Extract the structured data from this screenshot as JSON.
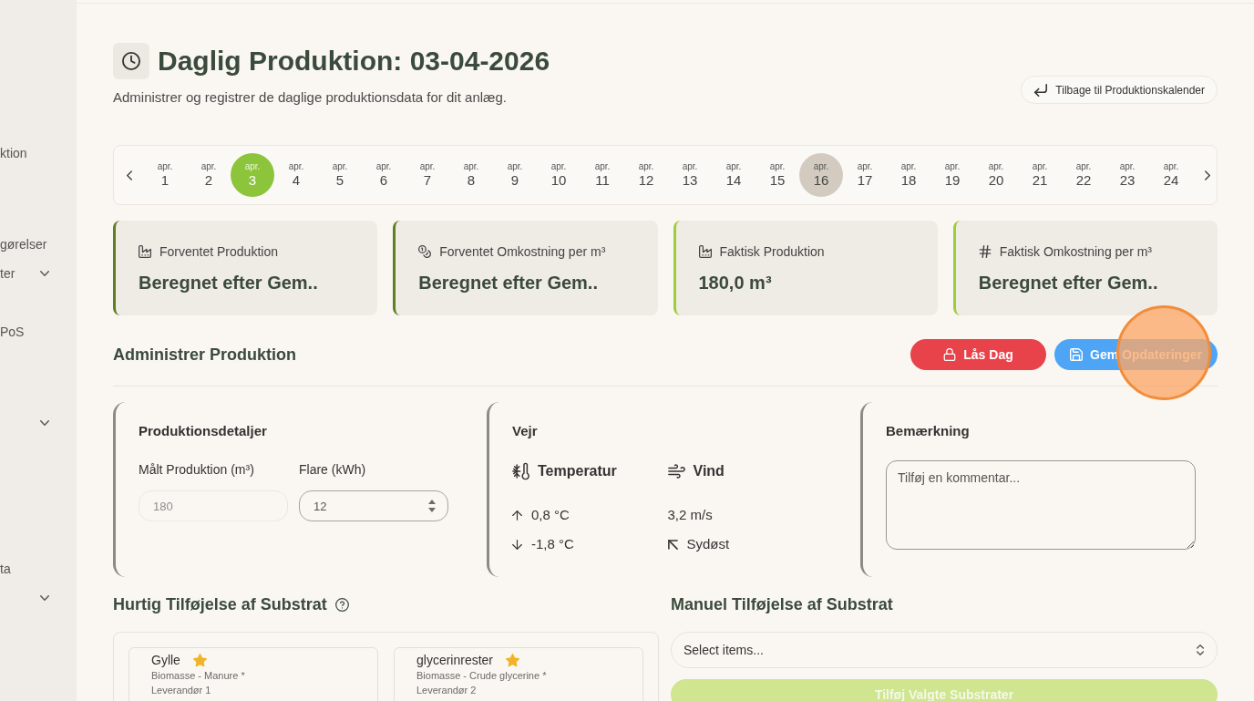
{
  "sidebar": {
    "items": [
      {
        "label": "ktion",
        "expandable": false
      },
      {
        "label": "gørelser",
        "expandable": false
      },
      {
        "label": "ter",
        "expandable": true
      },
      {
        "label": "PoS",
        "expandable": false
      },
      {
        "expandable": true
      },
      {
        "label": "ta",
        "expandable": false
      },
      {
        "expandable": true
      }
    ]
  },
  "header": {
    "title": "Daglig Produktion: 03-04-2026",
    "subtitle": "Administrer og registrer de daglige produktionsdata for dit anlæg.",
    "back_button": "Tilbage til Produktionskalender"
  },
  "date_strip": {
    "days": [
      {
        "month": "apr.",
        "day": "1",
        "selected": false,
        "highlighted": false
      },
      {
        "month": "apr.",
        "day": "2",
        "selected": false,
        "highlighted": false
      },
      {
        "month": "apr.",
        "day": "3",
        "selected": true,
        "highlighted": false
      },
      {
        "month": "apr.",
        "day": "4",
        "selected": false,
        "highlighted": false
      },
      {
        "month": "apr.",
        "day": "5",
        "selected": false,
        "highlighted": false
      },
      {
        "month": "apr.",
        "day": "6",
        "selected": false,
        "highlighted": false
      },
      {
        "month": "apr.",
        "day": "7",
        "selected": false,
        "highlighted": false
      },
      {
        "month": "apr.",
        "day": "8",
        "selected": false,
        "highlighted": false
      },
      {
        "month": "apr.",
        "day": "9",
        "selected": false,
        "highlighted": false
      },
      {
        "month": "apr.",
        "day": "10",
        "selected": false,
        "highlighted": false
      },
      {
        "month": "apr.",
        "day": "11",
        "selected": false,
        "highlighted": false
      },
      {
        "month": "apr.",
        "day": "12",
        "selected": false,
        "highlighted": false
      },
      {
        "month": "apr.",
        "day": "13",
        "selected": false,
        "highlighted": false
      },
      {
        "month": "apr.",
        "day": "14",
        "selected": false,
        "highlighted": false
      },
      {
        "month": "apr.",
        "day": "15",
        "selected": false,
        "highlighted": false
      },
      {
        "month": "apr.",
        "day": "16",
        "selected": false,
        "highlighted": true
      },
      {
        "month": "apr.",
        "day": "17",
        "selected": false,
        "highlighted": false
      },
      {
        "month": "apr.",
        "day": "18",
        "selected": false,
        "highlighted": false
      },
      {
        "month": "apr.",
        "day": "19",
        "selected": false,
        "highlighted": false
      },
      {
        "month": "apr.",
        "day": "20",
        "selected": false,
        "highlighted": false
      },
      {
        "month": "apr.",
        "day": "21",
        "selected": false,
        "highlighted": false
      },
      {
        "month": "apr.",
        "day": "22",
        "selected": false,
        "highlighted": false
      },
      {
        "month": "apr.",
        "day": "23",
        "selected": false,
        "highlighted": false
      },
      {
        "month": "apr.",
        "day": "24",
        "selected": false,
        "highlighted": false
      }
    ]
  },
  "summary_cards": [
    {
      "label": "Forventet Produktion",
      "value": "Beregnet efter Gem..",
      "color": "#5e7f22"
    },
    {
      "label": "Forventet Omkostning per m³",
      "value": "Beregnet efter Gem..",
      "color": "#5e7f22"
    },
    {
      "label": "Faktisk Produktion",
      "value": "180,0 m³",
      "color": "#9dcc3f"
    },
    {
      "label": "Faktisk Omkostning per m³",
      "value": "Beregnet efter Gem..",
      "color": "#9dcc3f"
    }
  ],
  "manage": {
    "title": "Administrer Produktion",
    "buttons": [
      {
        "label": "Lås Dag",
        "kind": "danger"
      },
      {
        "label": "Gem Opdateringer",
        "kind": "primary"
      }
    ]
  },
  "production_details": {
    "title": "Produktionsdetaljer",
    "fields": [
      {
        "label": "Målt Produktion (m³)",
        "value": "180",
        "kind": "text",
        "disabled": true
      },
      {
        "label": "Flare (kWh)",
        "value": "12",
        "kind": "number",
        "disabled": false
      }
    ]
  },
  "weather": {
    "title": "Vejr",
    "columns": [
      {
        "label": "Temperatur",
        "readings": [
          {
            "kind": "high",
            "text": "0,8 °C"
          },
          {
            "kind": "low",
            "text": "-1,8 °C"
          }
        ]
      },
      {
        "label": "Vind",
        "readings": [
          {
            "kind": "speed",
            "text": "3,2 m/s"
          },
          {
            "kind": "direction",
            "text": "Sydøst"
          }
        ]
      }
    ]
  },
  "remark": {
    "title": "Bemærkning",
    "placeholder": "Tilføj en kommentar..."
  },
  "quick_add": {
    "title": "Hurtig Tilføjelse af Substrat",
    "substrates": [
      {
        "name": "Gylle",
        "starred": true,
        "category": "Biomasse - Manure *",
        "supplier": "Leverandør 1"
      },
      {
        "name": "glycerinrester",
        "starred": true,
        "category": "Biomasse - Crude glycerine *",
        "supplier": "Leverandør 2"
      }
    ]
  },
  "manual_add": {
    "title": "Manuel Tilføjelse af Substrat",
    "select": {
      "placeholder": "Select items..."
    },
    "button": {
      "label": "Tilføj Valgte Substrater",
      "disabled": true
    }
  }
}
